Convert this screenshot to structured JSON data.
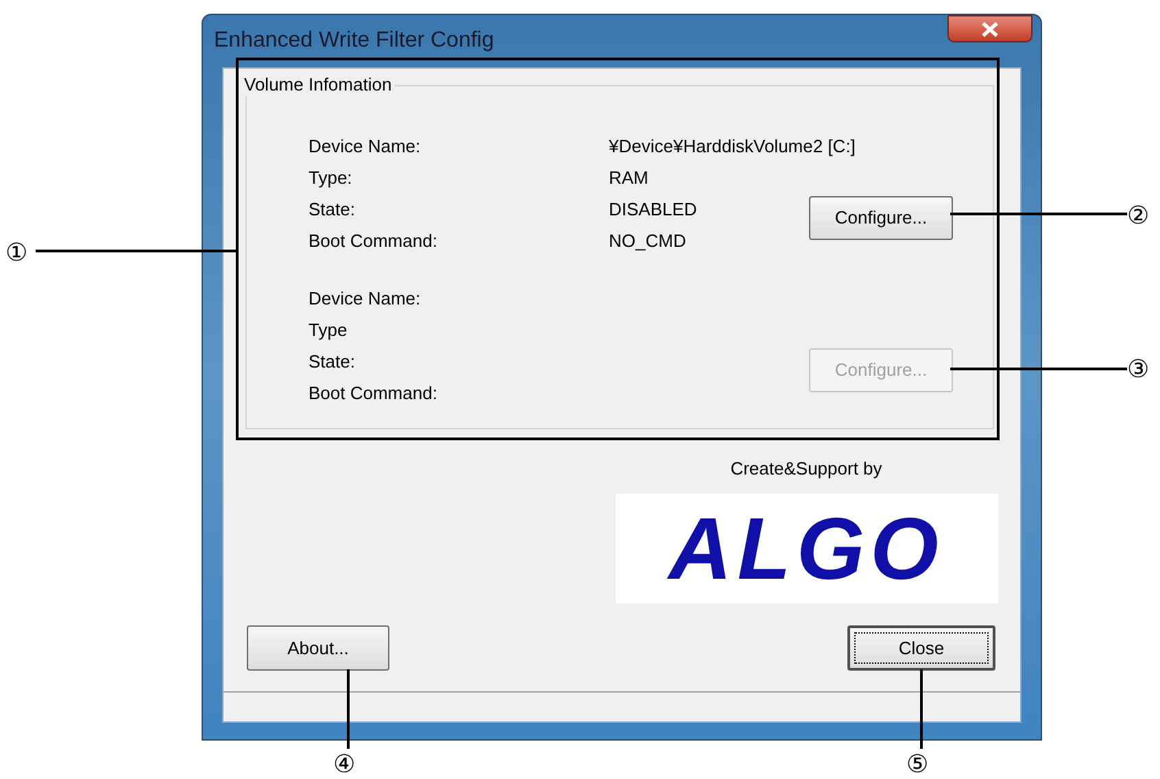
{
  "window": {
    "title": "Enhanced Write Filter Config"
  },
  "group": {
    "title": "Volume Infomation",
    "volumes": [
      {
        "fields": [
          {
            "label": "Device Name:",
            "value": "¥Device¥HarddiskVolume2 [C:]"
          },
          {
            "label": "Type:",
            "value": "RAM"
          },
          {
            "label": "State:",
            "value": "DISABLED"
          },
          {
            "label": "Boot Command:",
            "value": "NO_CMD"
          }
        ],
        "button": {
          "label": "Configure...",
          "disabled": false
        }
      },
      {
        "fields": [
          {
            "label": "Device Name:"
          },
          {
            "label": "Type"
          },
          {
            "label": "State:"
          },
          {
            "label": "Boot Command:"
          }
        ],
        "button": {
          "label": "Configure...",
          "disabled": true
        }
      }
    ]
  },
  "credit": "Create&Support by",
  "logo_text": "ALGO",
  "buttons": [
    {
      "label": "About...",
      "default": false
    },
    {
      "label": "Close",
      "default": true
    }
  ],
  "callouts": [
    "①",
    "②",
    "③",
    "④",
    "⑤"
  ]
}
